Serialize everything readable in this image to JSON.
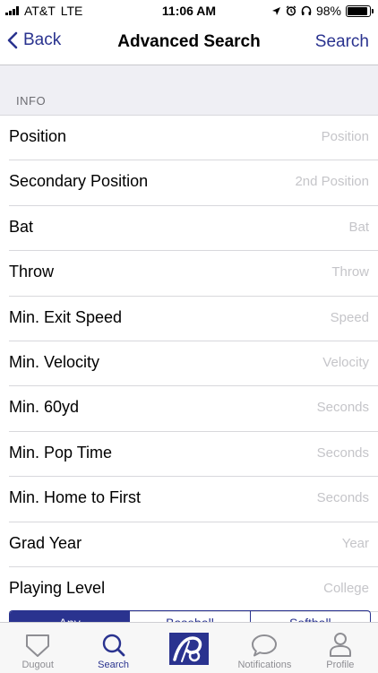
{
  "status": {
    "carrier": "AT&T",
    "network": "LTE",
    "time": "11:06 AM",
    "battery": "98%",
    "battery_level": 0.98
  },
  "nav": {
    "back_label": "Back",
    "title": "Advanced Search",
    "action_label": "Search"
  },
  "section": {
    "title": "INFO"
  },
  "rows": [
    {
      "label": "Position",
      "placeholder": "Position"
    },
    {
      "label": "Secondary Position",
      "placeholder": "2nd Position"
    },
    {
      "label": "Bat",
      "placeholder": "Bat"
    },
    {
      "label": "Throw",
      "placeholder": "Throw"
    },
    {
      "label": "Min. Exit Speed",
      "placeholder": "Speed"
    },
    {
      "label": "Min. Velocity",
      "placeholder": "Velocity"
    },
    {
      "label": "Min. 60yd",
      "placeholder": "Seconds"
    },
    {
      "label": "Min. Pop Time",
      "placeholder": "Seconds"
    },
    {
      "label": "Min. Home to First",
      "placeholder": "Seconds"
    },
    {
      "label": "Grad Year",
      "placeholder": "Year"
    },
    {
      "label": "Playing Level",
      "placeholder": "College"
    }
  ],
  "segments": [
    "Any",
    "Baseball",
    "Softball"
  ],
  "tabs": [
    {
      "label": "Dugout",
      "icon": "shield-icon"
    },
    {
      "label": "Search",
      "icon": "search-icon",
      "active": true
    },
    {
      "label": "",
      "icon": "app-logo-icon"
    },
    {
      "label": "Notifications",
      "icon": "chat-bubble-icon"
    },
    {
      "label": "Profile",
      "icon": "person-icon"
    }
  ],
  "colors": {
    "accent": "#2a338f",
    "placeholder": "#c5c5c9",
    "section_bg": "#efeff4"
  }
}
